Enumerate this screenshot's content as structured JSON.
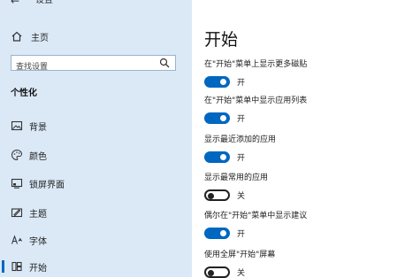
{
  "window": {
    "title": "设置"
  },
  "sidebar": {
    "home_label": "主页",
    "search_placeholder": "查找设置",
    "section_title": "个性化",
    "items": [
      {
        "label": "背景",
        "icon": "picture-icon",
        "selected": false
      },
      {
        "label": "颜色",
        "icon": "palette-icon",
        "selected": false
      },
      {
        "label": "锁屏界面",
        "icon": "lock-screen-icon",
        "selected": false
      },
      {
        "label": "主题",
        "icon": "theme-icon",
        "selected": false
      },
      {
        "label": "字体",
        "icon": "font-icon",
        "selected": false
      },
      {
        "label": "开始",
        "icon": "start-icon",
        "selected": true
      }
    ]
  },
  "main": {
    "title": "开始",
    "settings": [
      {
        "caption": "在\"开始\"菜单上显示更多磁贴",
        "state": "开",
        "on": true
      },
      {
        "caption": "在\"开始\"菜单中显示应用列表",
        "state": "开",
        "on": true
      },
      {
        "caption": "显示最近添加的应用",
        "state": "开",
        "on": true
      },
      {
        "caption": "显示最常用的应用",
        "state": "关",
        "on": false
      },
      {
        "caption": "偶尔在\"开始\"菜单中显示建议",
        "state": "开",
        "on": true
      },
      {
        "caption": "使用全屏\"开始\"屏幕",
        "state": "关",
        "on": false
      }
    ]
  },
  "colors": {
    "sidebar_bg": "#dbe9f7",
    "accent": "#0067c0"
  }
}
